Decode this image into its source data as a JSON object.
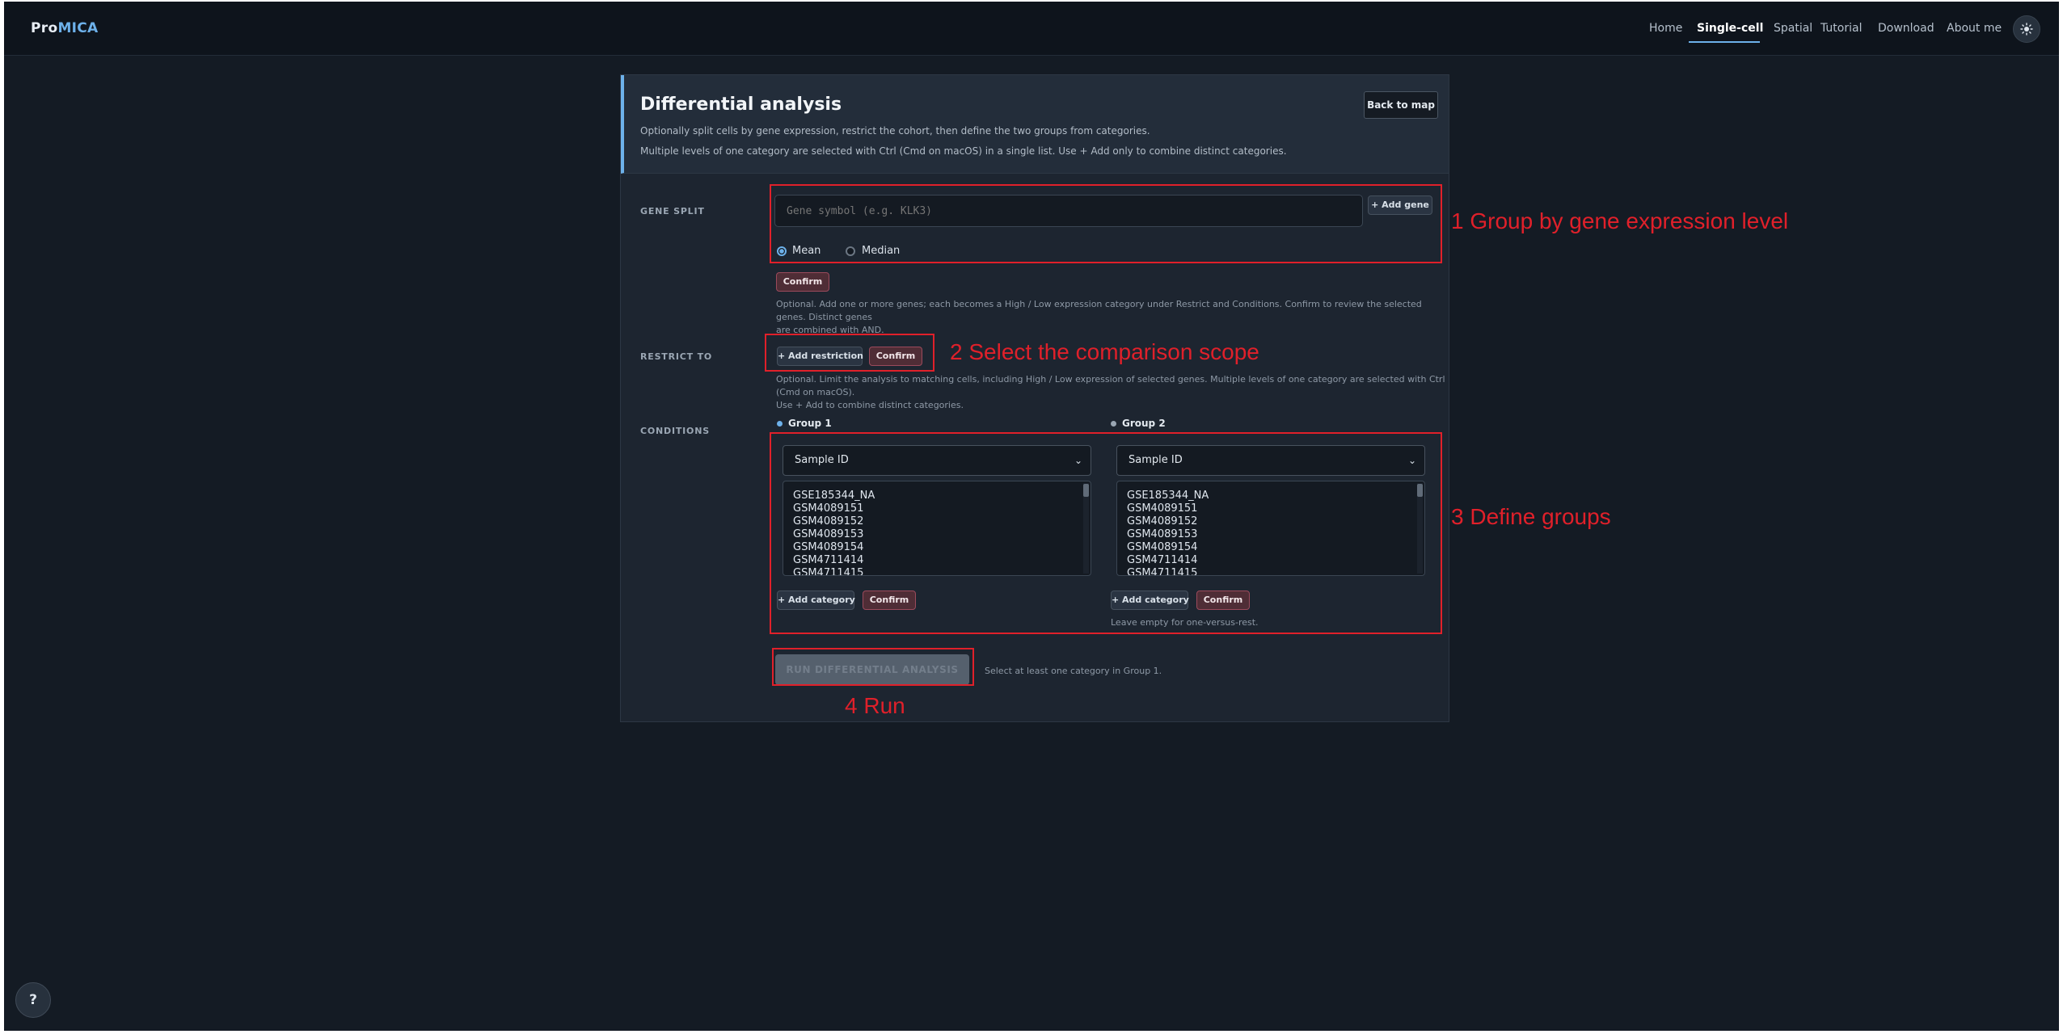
{
  "nav": {
    "logo_pro": "Pro",
    "logo_mica": "MICA",
    "links": [
      "Home",
      "Single-cell",
      "Spatial",
      "Tutorial",
      "Download",
      "About me"
    ],
    "active": "Single-cell",
    "theme_icon": "sun-icon"
  },
  "card": {
    "title": "Differential analysis",
    "desc1": "Optionally split cells by gene expression, restrict the cohort, then define the two groups from categories.",
    "desc2": "Multiple levels of one category are selected with Ctrl (Cmd on macOS) in a single list. Use + Add only to combine distinct categories.",
    "back_label": "Back to map"
  },
  "gene_split": {
    "label": "GENE SPLIT",
    "placeholder": "Gene symbol (e.g. KLK3)",
    "add_gene_label": "+ Add gene",
    "mean_label": "Mean",
    "median_label": "Median",
    "selected": "Mean",
    "confirm_label": "Confirm",
    "help_line1": "Optional. Add one or more genes; each becomes a High / Low expression category under Restrict and Conditions. Confirm to review the selected genes. Distinct genes",
    "help_line2": "are combined with AND."
  },
  "restrict": {
    "label": "RESTRICT TO",
    "add_label": "+ Add restriction",
    "confirm_label": "Confirm",
    "help_line1": "Optional. Limit the analysis to matching cells, including High / Low expression of selected genes. Multiple levels of one category are selected with Ctrl (Cmd on macOS).",
    "help_line2": "Use + Add to combine distinct categories."
  },
  "conditions": {
    "label": "CONDITIONS",
    "groups": [
      {
        "title": "Group 1",
        "dot_color": "#6db1ea",
        "category": "Sample ID",
        "options": [
          "GSE185344_NA",
          "GSM4089151",
          "GSM4089152",
          "GSM4089153",
          "GSM4089154",
          "GSM4711414",
          "GSM4711415"
        ],
        "add_label": "+ Add category",
        "confirm_label": "Confirm",
        "note": ""
      },
      {
        "title": "Group 2",
        "dot_color": "#9aa6b3",
        "category": "Sample ID",
        "options": [
          "GSE185344_NA",
          "GSM4089151",
          "GSM4089152",
          "GSM4089153",
          "GSM4089154",
          "GSM4711414",
          "GSM4711415"
        ],
        "add_label": "+ Add category",
        "confirm_label": "Confirm",
        "note": "Leave empty for one-versus-rest."
      }
    ]
  },
  "run": {
    "label": "RUN DIFFERENTIAL ANALYSIS",
    "hint": "Select at least one category in Group 1."
  },
  "annotations": {
    "step1": "1 Group by gene expression level",
    "step2": "2 Select the comparison scope",
    "step3": "3 Define groups",
    "step4": "4 Run",
    "color": "#e0202a"
  },
  "help_fab": "?"
}
